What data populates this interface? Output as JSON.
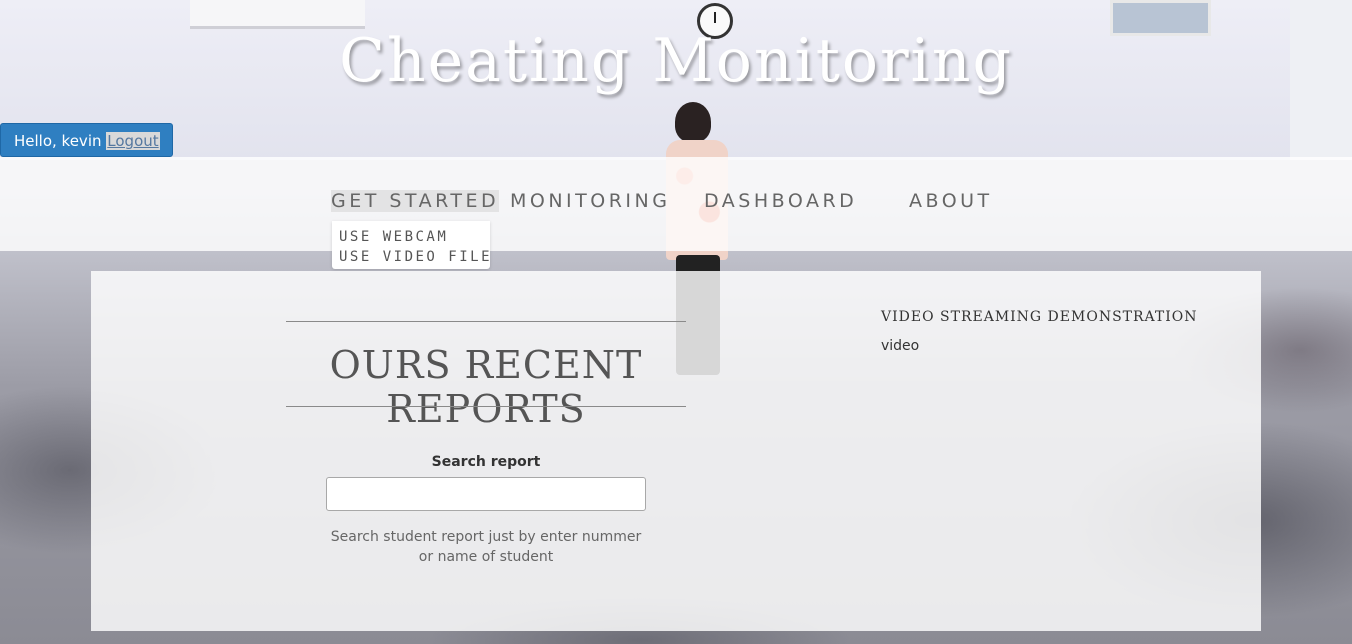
{
  "header": {
    "site_title": "Cheating Monitoring"
  },
  "user": {
    "greeting": "Hello, kevin",
    "logout_label": "Logout"
  },
  "nav": {
    "items": [
      {
        "label": "GET STARTED"
      },
      {
        "label": "MONITORING"
      },
      {
        "label": "DASHBOARD"
      },
      {
        "label": "ABOUT"
      }
    ],
    "active_item": "GET STARTED",
    "dropdown": [
      {
        "label": "USE WEBCAM"
      },
      {
        "label": "USE VIDEO FILE"
      }
    ]
  },
  "reports": {
    "title": "OURS RECENT REPORTS",
    "search_label": "Search report",
    "search_value": "",
    "search_help": "Search student report just by enter nummer or name of student"
  },
  "video": {
    "title": "VIDEO STREAMING DEMONSTRATION",
    "text": "video"
  },
  "colors": {
    "user_button_bg": "#2f7fc1",
    "nav_text": "#666666",
    "panel_bg": "#ffffff"
  }
}
